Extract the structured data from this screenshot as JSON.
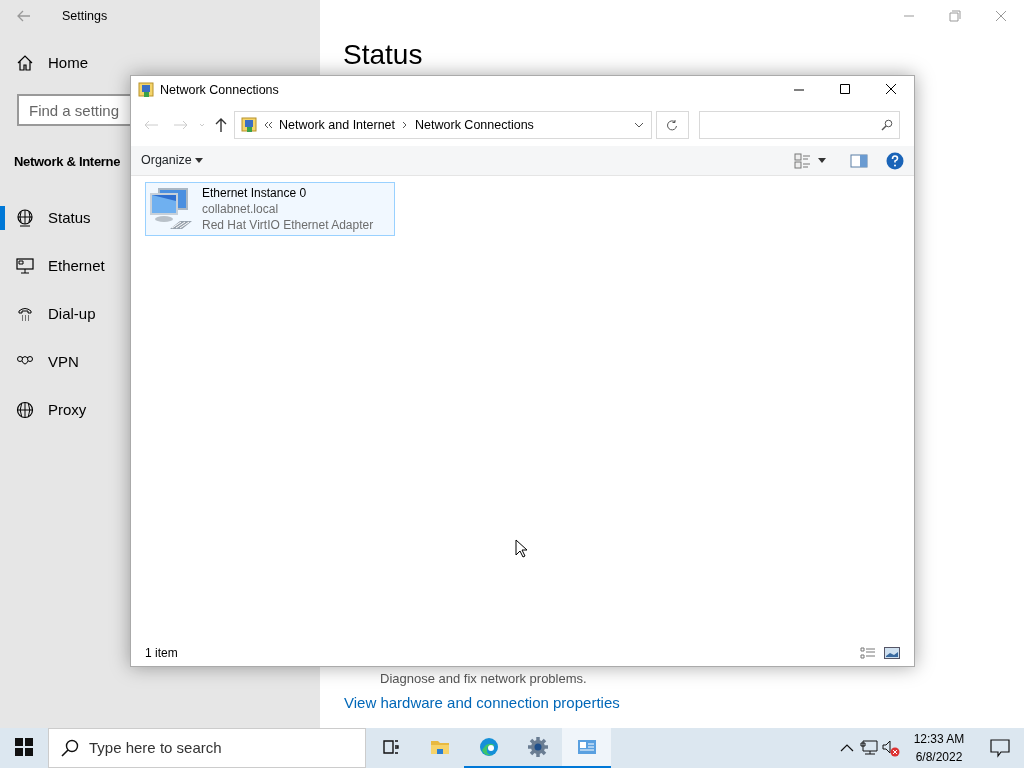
{
  "settings": {
    "title": "Settings",
    "home": "Home",
    "search": {
      "placeholder": "Find a setting"
    },
    "section": "Network & Interne",
    "nav": [
      {
        "label": "Status",
        "selected": true
      },
      {
        "label": "Ethernet",
        "selected": false
      },
      {
        "label": "Dial-up",
        "selected": false
      },
      {
        "label": "VPN",
        "selected": false
      },
      {
        "label": "Proxy",
        "selected": false
      }
    ],
    "page_title": "Status",
    "partial_text": "Diagnose and fix network problems.",
    "link": "View hardware and connection properties"
  },
  "explorer": {
    "title": "Network Connections",
    "breadcrumb": [
      "Network and Internet",
      "Network Connections"
    ],
    "organize": "Organize",
    "items": [
      {
        "name": "Ethernet Instance 0",
        "domain": "collabnet.local",
        "adapter": "Red Hat VirtIO Ethernet Adapter",
        "selected": true
      }
    ],
    "status": "1 item"
  },
  "taskbar": {
    "search_placeholder": "Type here to search",
    "apps": [
      {
        "kind": "taskview",
        "running": false,
        "selected": false
      },
      {
        "kind": "folder",
        "running": false,
        "selected": false
      },
      {
        "kind": "browser",
        "running": true,
        "selected": false
      },
      {
        "kind": "settings",
        "running": true,
        "selected": false
      },
      {
        "kind": "network",
        "running": true,
        "selected": true
      }
    ],
    "time": "12:33 AM",
    "date": "6/8/2022"
  }
}
